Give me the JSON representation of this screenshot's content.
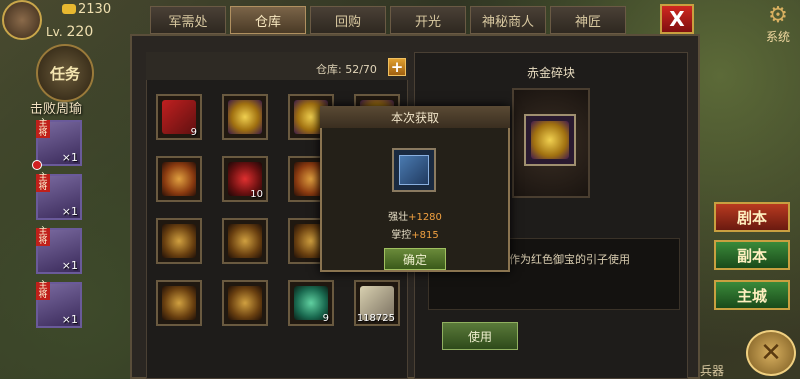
{
  "hud": {
    "gold": "2130",
    "level_prefix": "Lv.",
    "level": "220",
    "quest_label": "任务",
    "quest_text": "击败周瑜",
    "hero_count": "×1",
    "hero_badge": "主将"
  },
  "tabs": [
    {
      "label": "军需处",
      "active": false
    },
    {
      "label": "仓库",
      "active": true
    },
    {
      "label": "回购",
      "active": false
    },
    {
      "label": "开光",
      "active": false
    },
    {
      "label": "神秘商人",
      "active": false
    },
    {
      "label": "神匠",
      "active": false
    }
  ],
  "close_label": "X",
  "storage": {
    "label": "仓库: 52/70",
    "plus": "+"
  },
  "slots": [
    {
      "count": "9",
      "icon": "red-token-icon"
    },
    {
      "count": "",
      "icon": "gold-fragment-icon"
    },
    {
      "count": "",
      "icon": "gold-fragment-icon"
    },
    {
      "count": "",
      "icon": "gold-fragment-icon"
    },
    {
      "count": "",
      "icon": "armor-icon"
    },
    {
      "count": "10",
      "icon": "red-gem-icon"
    },
    {
      "count": "",
      "icon": "armor-icon"
    },
    {
      "count": "",
      "icon": "armor-icon"
    },
    {
      "count": "",
      "icon": "helmet-icon"
    },
    {
      "count": "",
      "icon": "helmet-icon"
    },
    {
      "count": "",
      "icon": "helmet-icon"
    },
    {
      "count": "",
      "icon": "helmet-icon"
    },
    {
      "count": "",
      "icon": "helmet-icon"
    },
    {
      "count": "",
      "icon": "helmet-icon"
    },
    {
      "count": "9",
      "icon": "jade-icon"
    },
    {
      "count": "118725",
      "icon": "scroll-icon"
    }
  ],
  "detail": {
    "title": "赤金碎块",
    "description": "赤的碎金块，可作为红色御宝的引子使用",
    "use_label": "使用"
  },
  "popup": {
    "title": "本次获取",
    "item_icon": "blue-book-icon",
    "stat1_label": "强壮",
    "stat1_value": "+1280",
    "stat2_label": "掌控",
    "stat2_value": "+815",
    "ok_label": "确定"
  },
  "right_hud": {
    "system_label": "系统",
    "story_label": "剧本",
    "dungeon_label": "副本",
    "city_label": "主城",
    "weapon_label": "兵器"
  }
}
